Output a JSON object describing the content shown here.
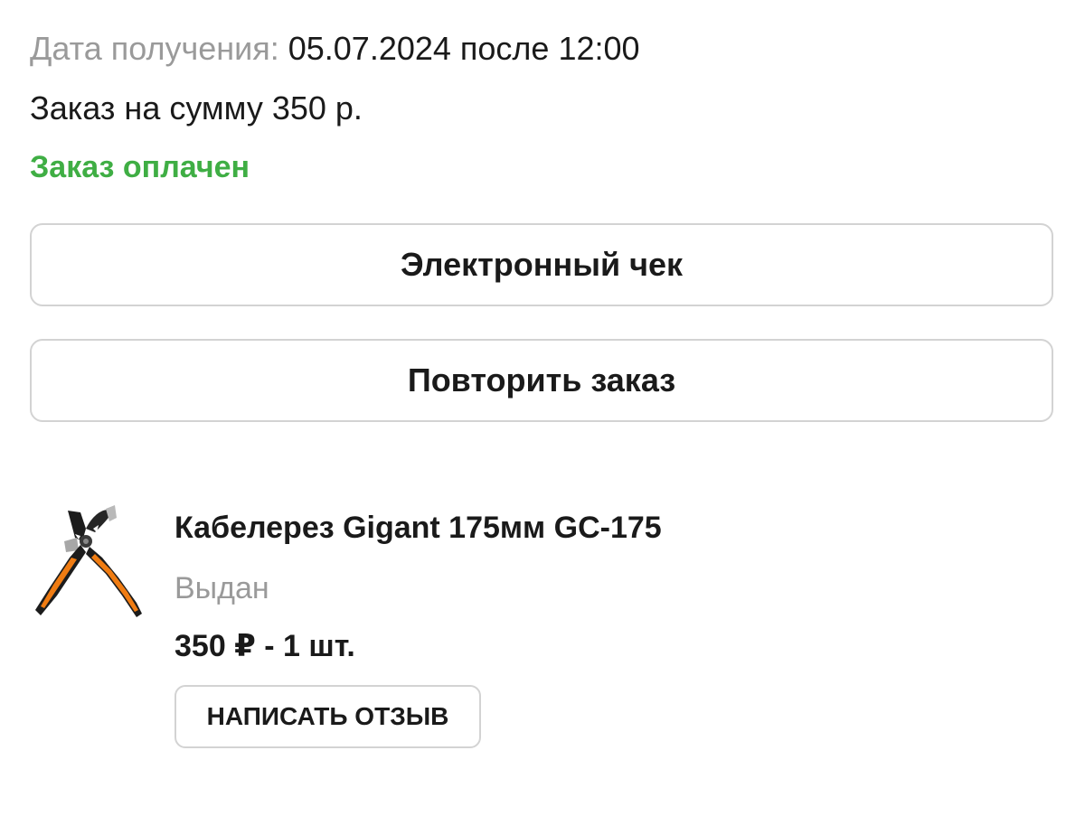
{
  "order": {
    "date_label": "Дата получения:",
    "date_value": "05.07.2024 после 12:00",
    "sum_text": "Заказ на сумму 350 р.",
    "status_text": "Заказ оплачен",
    "status_color": "#3fae44"
  },
  "actions": {
    "receipt_label": "Электронный чек",
    "repeat_label": "Повторить заказ"
  },
  "item": {
    "image": "cable-cutter-icon",
    "title": "Кабелерез Gigant 175мм GC-175",
    "status": "Выдан",
    "price_qty": "350 ₽ - 1 шт.",
    "review_label": "НАПИСАТЬ ОТЗЫВ"
  },
  "colors": {
    "muted_text": "#9a9a9a",
    "border": "#d3d3d3",
    "tool_orange": "#f07c12"
  }
}
